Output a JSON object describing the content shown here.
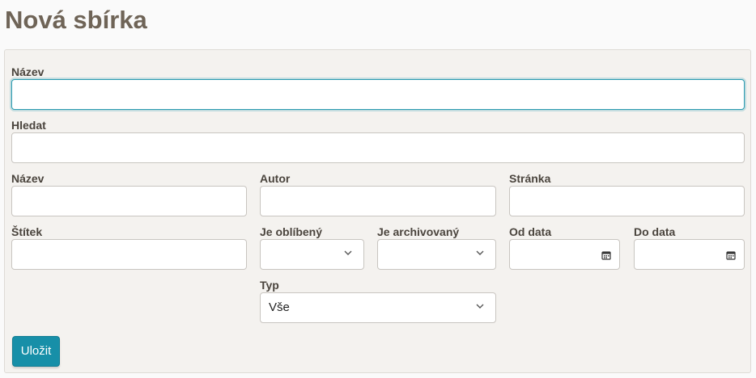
{
  "page": {
    "title": "Nová sbírka"
  },
  "form": {
    "name_label": "Název",
    "name_value": "",
    "search_label": "Hledat",
    "search_value": "",
    "title_label": "Název",
    "author_label": "Autor",
    "page_label": "Stránka",
    "tag_label": "Štítek",
    "favorite_label": "Je oblíbený",
    "favorite_value": "",
    "archived_label": "Je archivovaný",
    "archived_value": "",
    "from_date_label": "Od data",
    "to_date_label": "Do data",
    "type_label": "Typ",
    "type_value": "Vše",
    "save_label": "Uložit"
  },
  "icons": {
    "select_arrow": "chevron-down-icon",
    "date_picker": "calendar-icon"
  },
  "colors": {
    "title": "#6f6457",
    "primary_button": "#178fa8",
    "focus_border": "#2a9bb0",
    "panel_bg": "#f4f2ef"
  }
}
